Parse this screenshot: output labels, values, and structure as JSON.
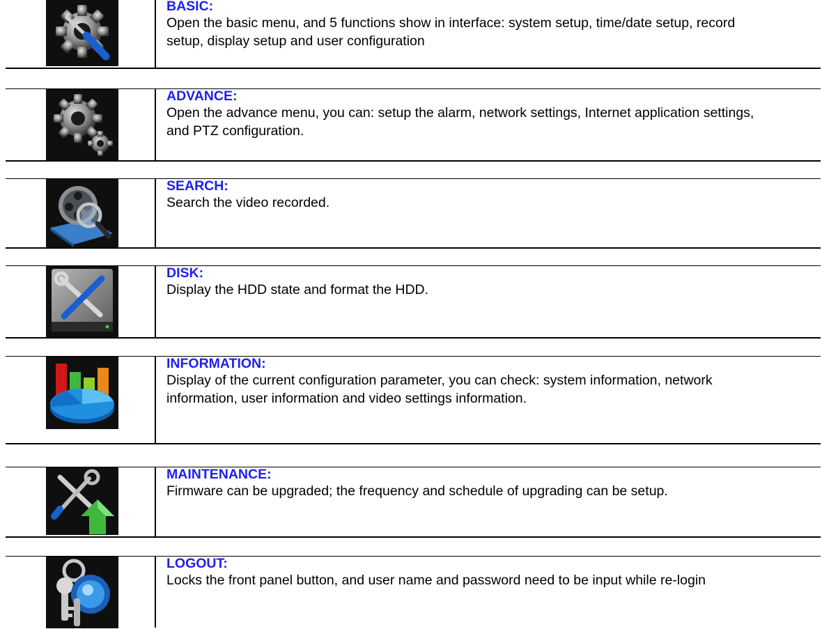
{
  "items": [
    {
      "title": "BASIC:",
      "icon": "gear-screwdriver-icon",
      "description": "Open the basic menu, and 5 functions show in interface: system setup, time/date setup, record setup, display setup and user configuration"
    },
    {
      "title": "ADVANCE:",
      "icon": "gears-icon",
      "description": "Open the advance menu, you can: setup the alarm, network settings, Internet application settings, and PTZ configuration."
    },
    {
      "title": "SEARCH:",
      "icon": "film-reel-magnifier-icon",
      "description": "Search the video recorded."
    },
    {
      "title": "DISK:",
      "icon": "hard-disk-tools-icon",
      "description": "Display the HDD state and format the HDD."
    },
    {
      "title": "INFORMATION:",
      "icon": "chart-pie-icon",
      "description": "Display of the current configuration parameter, you can check: system information, network information, user information and video settings information."
    },
    {
      "title": "MAINTENANCE:",
      "icon": "tools-upgrade-arrow-icon",
      "description": "Firmware can be upgraded; the frequency and schedule of upgrading can be setup."
    },
    {
      "title": "LOGOUT:",
      "icon": "keys-icon",
      "description": "Locks the front panel button, and user name and password need to be input while re-login"
    }
  ]
}
